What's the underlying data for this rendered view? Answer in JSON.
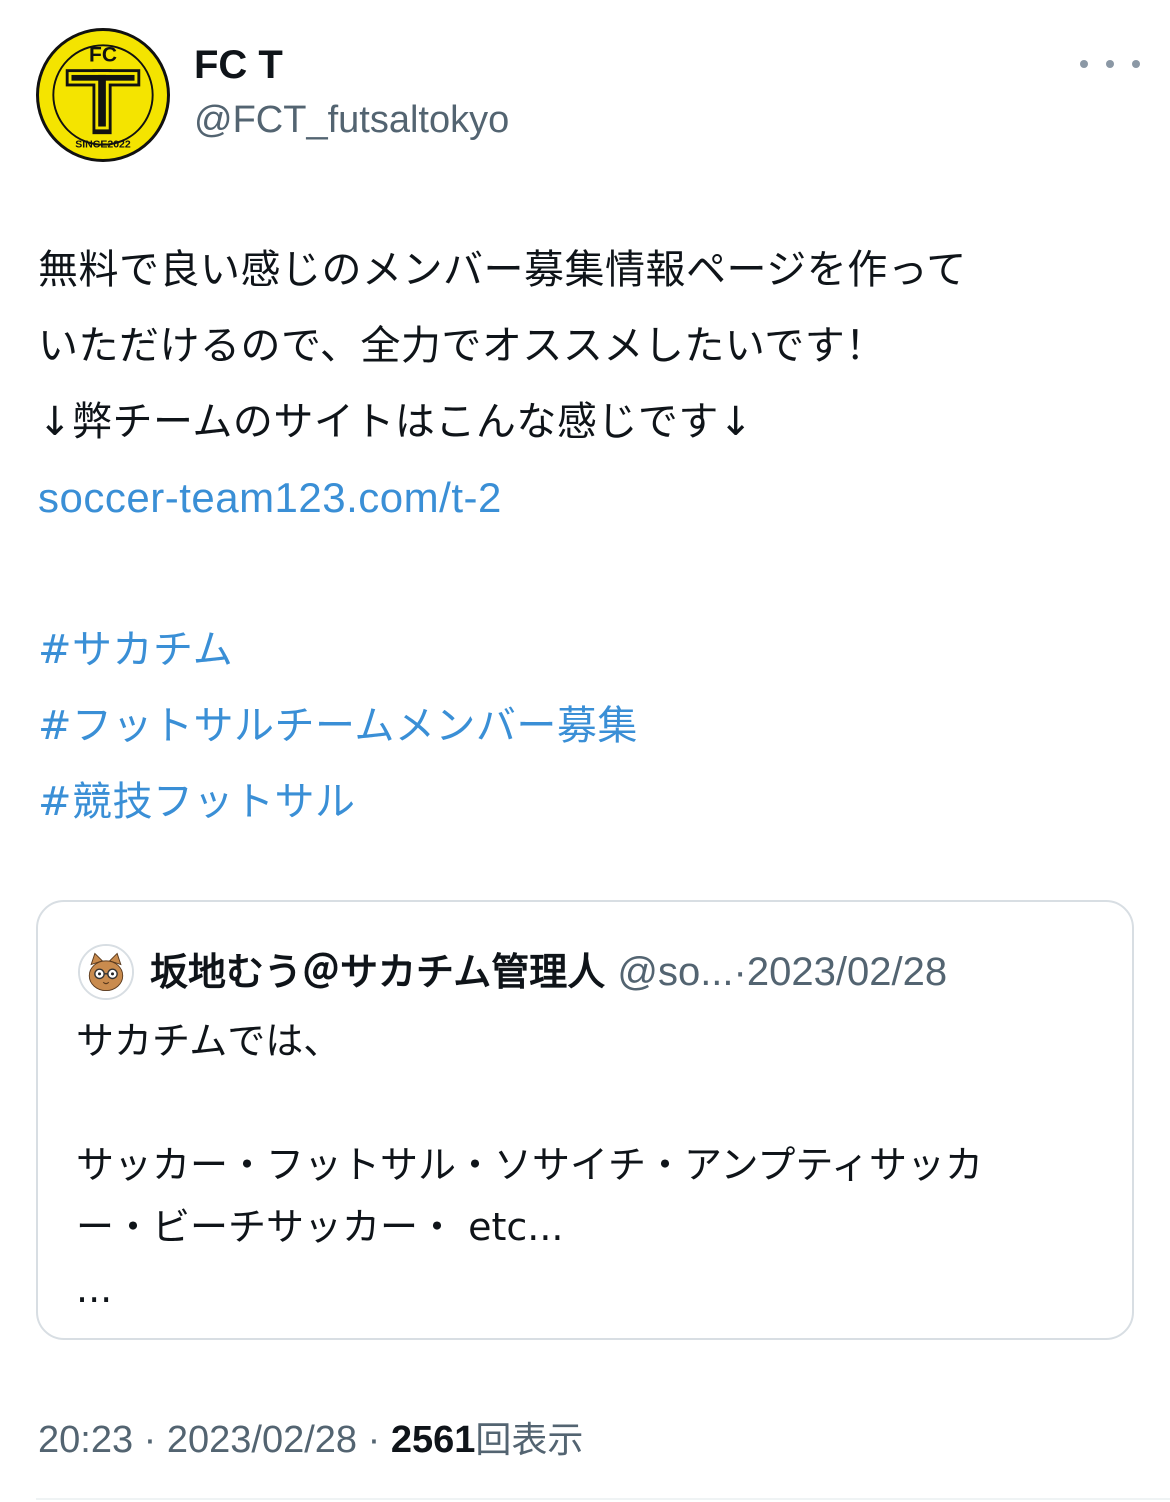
{
  "author": {
    "display_name": "FC T",
    "handle": "@FCT_futsaltokyo",
    "avatar_text_top": "FC",
    "avatar_text_bottom": "SINCE2022"
  },
  "more_icon": "more-horizontal-icon",
  "tweet": {
    "lines": [
      "無料で良い感じのメンバー募集情報ページを作って",
      "いただけるので、全力でオススメしたいです！",
      "↓弊チームのサイトはこんな感じです↓"
    ],
    "link": "soccer-team123.com/t-2",
    "hashtags": [
      "#サカチム",
      "#フットサルチームメンバー募集",
      "#競技フットサル"
    ]
  },
  "quoted_tweet": {
    "name": "坂地むう＠サカチム管理人",
    "handle": "@so...",
    "separator": "·",
    "date": "2023/02/28",
    "body_lines": [
      "サカチムでは、",
      "",
      "サッカー・フットサル・ソサイチ・アンプティサッカ",
      "ー・ビーチサッカー・ etc...",
      "..."
    ]
  },
  "meta": {
    "time": "20:23",
    "separator": "·",
    "date": "2023/02/28",
    "view_count": "2561",
    "views_label": "回表示"
  },
  "colors": {
    "link": "#3a8fd6",
    "secondary_text": "#536471",
    "avatar_yellow": "#f4e400"
  }
}
